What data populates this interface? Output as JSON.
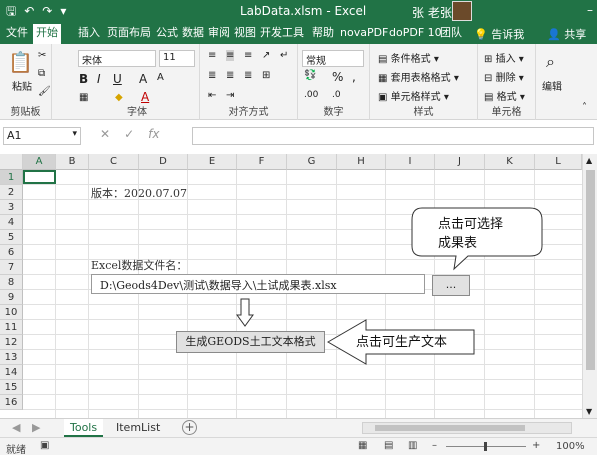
{
  "titlebar": {
    "title": "LabData.xlsm  -  Excel",
    "user": "张 老张",
    "qat_icons": [
      "save-icon",
      "undo-icon",
      "redo-icon",
      "customize-icon"
    ]
  },
  "tabs": [
    "文件",
    "开始",
    "插入",
    "页面布局",
    "公式",
    "数据",
    "审阅",
    "视图",
    "开发工具",
    "帮助",
    "novaPDF",
    "doPDF 10",
    "团队"
  ],
  "tell_me": "告诉我",
  "share": "共享",
  "ribbon": {
    "clipboard": {
      "paste": "粘贴",
      "label": "剪贴板"
    },
    "font": {
      "name": "宋体",
      "size": "11",
      "label": "字体"
    },
    "alignment": {
      "label": "对齐方式"
    },
    "number": {
      "format": "常规",
      "label": "数字"
    },
    "styles": {
      "conditional": "条件格式",
      "table": "套用表格格式",
      "cell": "单元格样式",
      "label": "样式"
    },
    "cells": {
      "insert": "插入",
      "delete": "删除",
      "format": "格式",
      "label": "单元格"
    },
    "editing": {
      "label": "编辑"
    }
  },
  "formula_bar": {
    "name_box": "A1",
    "formula": ""
  },
  "columns": [
    "A",
    "B",
    "C",
    "D",
    "E",
    "F",
    "G",
    "H",
    "I",
    "J",
    "K",
    "L"
  ],
  "rows": [
    "1",
    "2",
    "3",
    "4",
    "5",
    "6",
    "7",
    "8",
    "9",
    "10",
    "11",
    "12",
    "13",
    "14",
    "15",
    "16"
  ],
  "sheet": {
    "version": "版本：2020.07.07",
    "excel_label": "Excel数据文件名：",
    "file_path": "D:\\Geods4Dev\\测试\\数据导入\\土试成果表.xlsx",
    "browse_button": "...",
    "generate_button": "生成GEODS土工文本格式",
    "callout1_line1": "点击可选择",
    "callout1_line2": "成果表",
    "callout2": "点击可生产文本"
  },
  "sheet_tabs": [
    "Tools",
    "ItemList"
  ],
  "status": {
    "ready": "就绪",
    "zoom": "100%"
  },
  "colors": {
    "excel_green": "#217346"
  }
}
